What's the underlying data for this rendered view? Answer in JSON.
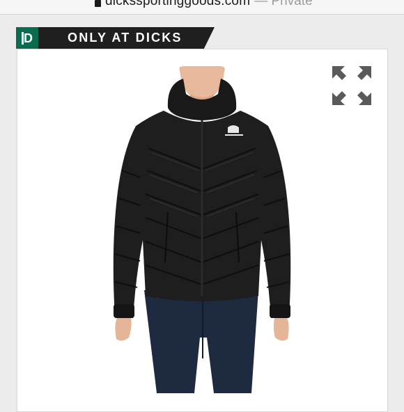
{
  "browser": {
    "url": "dickssportinggoods.com",
    "mode": "— Private"
  },
  "badge": {
    "logo_letter": "D",
    "title": "ONLY AT DICKS",
    "logo_color": "#0b6b4f",
    "bar_color": "#1f1f1f"
  },
  "product": {
    "image_alt": "Black hooded quilted puffer jacket",
    "jacket_color": "#1e1e1f",
    "expand_icon": "expand-icon"
  }
}
